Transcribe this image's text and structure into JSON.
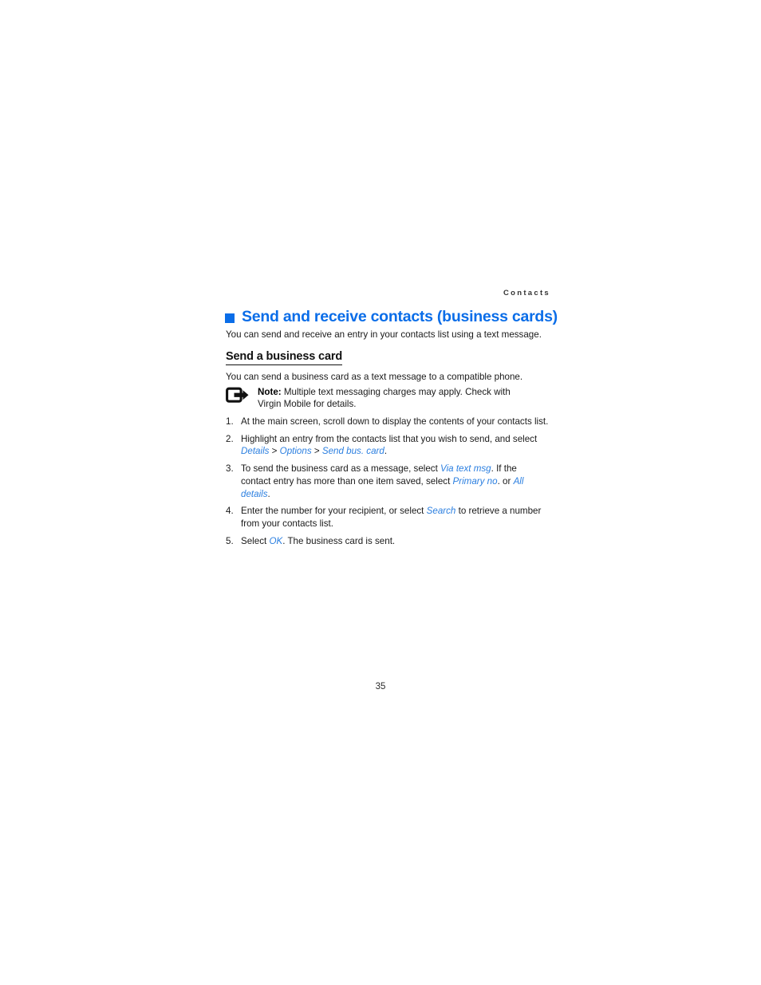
{
  "running_head": "Contacts",
  "chapter": {
    "bullet_color": "#0a6de8",
    "title": "Send and receive contacts (business cards)",
    "intro": "You can send and receive an entry in your contacts list using a text message."
  },
  "section": {
    "heading": "Send a business card",
    "intro": "You can send a business card as a text message to a compatible phone."
  },
  "note": {
    "icon": "note-arrow-icon",
    "label": "Note:",
    "text": "Multiple text messaging charges may apply. Check with Virgin Mobile for details."
  },
  "steps": [
    {
      "number": "1.",
      "parts": [
        {
          "type": "text",
          "value": "At the main screen, scroll down to display the contents of your contacts list."
        }
      ]
    },
    {
      "number": "2.",
      "parts": [
        {
          "type": "text",
          "value": "Highlight an entry from the contacts list that you wish to send, and select "
        },
        {
          "type": "term",
          "value": "Details"
        },
        {
          "type": "text",
          "value": " > "
        },
        {
          "type": "term",
          "value": "Options"
        },
        {
          "type": "text",
          "value": " > "
        },
        {
          "type": "term",
          "value": "Send bus. card"
        },
        {
          "type": "text",
          "value": "."
        }
      ]
    },
    {
      "number": "3.",
      "parts": [
        {
          "type": "text",
          "value": "To send the business card as a message, select "
        },
        {
          "type": "term",
          "value": "Via text msg"
        },
        {
          "type": "text",
          "value": ". If the contact entry has more than one item saved, select "
        },
        {
          "type": "term",
          "value": "Primary no"
        },
        {
          "type": "text",
          "value": ". or "
        },
        {
          "type": "term",
          "value": "All details"
        },
        {
          "type": "text",
          "value": "."
        }
      ]
    },
    {
      "number": "4.",
      "parts": [
        {
          "type": "text",
          "value": "Enter the number for your recipient, or select "
        },
        {
          "type": "term",
          "value": "Search"
        },
        {
          "type": "text",
          "value": " to retrieve a number from your contacts list."
        }
      ]
    },
    {
      "number": "5.",
      "parts": [
        {
          "type": "text",
          "value": "Select "
        },
        {
          "type": "term",
          "value": "OK"
        },
        {
          "type": "text",
          "value": ". The business card is sent."
        }
      ]
    }
  ],
  "page_number": "35"
}
